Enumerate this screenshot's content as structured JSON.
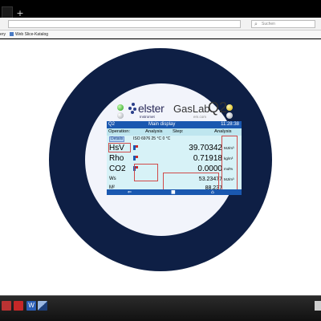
{
  "browser": {
    "new_tab_symbol": "+",
    "search_placeholder": "Suchen",
    "bookmarks": [
      {
        "label": "ery",
        "icon": "bookmark-icon"
      },
      {
        "label": "Web Slice-Katalog",
        "icon": "web-slice-icon"
      }
    ]
  },
  "device": {
    "brand": "elster",
    "brand_sub": "Instromet",
    "product": "GasLab",
    "product_q": "Q2",
    "product_sub": "em.com",
    "title_left": "Q2",
    "title_center": "Main display",
    "time": "11:28:38",
    "operation_label": "Operation:",
    "operation_value": "Analysis",
    "step_label": "Step:",
    "step_value": "Analysis",
    "details_button": "Details",
    "iso_text": "ISO 6976  25 °C  0 °C",
    "rows": [
      {
        "label": "HsV",
        "value": "39.70342",
        "unit": "MJ/m³"
      },
      {
        "label": "Rho",
        "value": "0.71918",
        "unit": "kg/m³"
      },
      {
        "label": "CO2",
        "value": "0.0000",
        "unit": "mol%"
      },
      {
        "label": "Ws",
        "value": "53.23477",
        "unit": "MJ/m³"
      },
      {
        "label": "M²",
        "value": "88.237",
        "unit": ""
      }
    ],
    "nav": {
      "back": "⇐",
      "mid": "■",
      "home": "⌂"
    }
  },
  "colors": {
    "ring": "#0e1f45",
    "screen": "#d7f2f7",
    "header_blue": "#1a58b0",
    "accent_red": "#d04a4a"
  }
}
